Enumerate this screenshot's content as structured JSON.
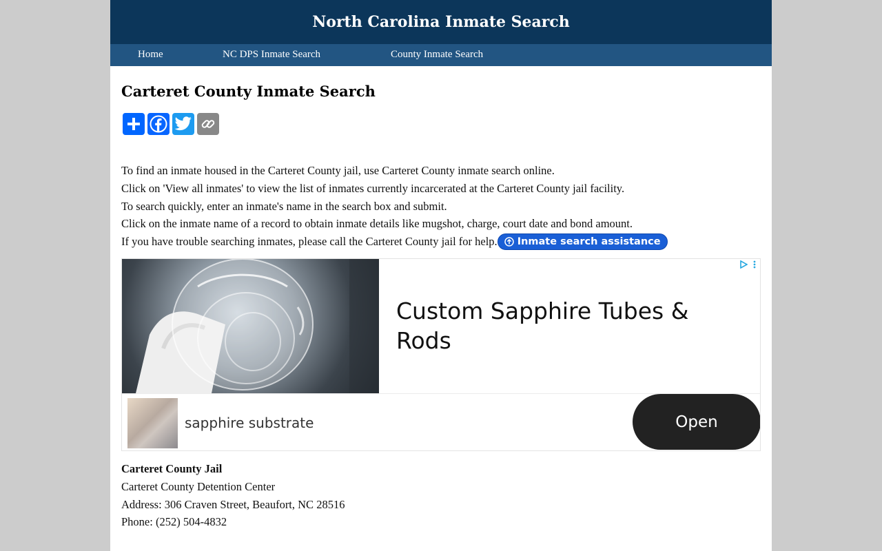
{
  "header": {
    "title": "North Carolina Inmate Search"
  },
  "nav": {
    "items": [
      "Home",
      "NC DPS Inmate Search",
      "County Inmate Search"
    ]
  },
  "main": {
    "heading": "Carteret County Inmate Search",
    "share_buttons": [
      {
        "label": "Share",
        "icon": "plus-icon",
        "color": "#0166ff"
      },
      {
        "label": "Facebook",
        "icon": "facebook-icon",
        "color": "#0866ff"
      },
      {
        "label": "Twitter",
        "icon": "twitter-icon",
        "color": "#1d9bf0"
      },
      {
        "label": "Copy Link",
        "icon": "link-icon",
        "color": "#888888"
      }
    ],
    "intro_lines": [
      "To find an inmate housed in the Carteret County jail, use Carteret County inmate search online.",
      "Click on 'View all inmates' to view the list of inmates currently incarcerated at the Carteret County jail facility.",
      "To search quickly, enter an inmate's name in the search box and submit.",
      "Click on the inmate name of a record to obtain inmate details like mugshot, charge, court date and bond amount.",
      "If you have trouble searching inmates, please call the Carteret County jail for help."
    ],
    "assist_button": "Inmate search assistance"
  },
  "ad": {
    "headline": "Custom Sapphire Tubes & Rods",
    "subtitle": "sapphire substrate",
    "cta": "Open"
  },
  "jail": {
    "title": "Carteret County Jail",
    "name": "Carteret County Detention Center",
    "address": "Address: 306 Craven Street, Beaufort, NC 28516",
    "phone": "Phone: (252) 504-4832"
  },
  "colors": {
    "header_bg": "#0c365a",
    "nav_bg": "#225582",
    "assist_button": "#1a5fd6"
  }
}
